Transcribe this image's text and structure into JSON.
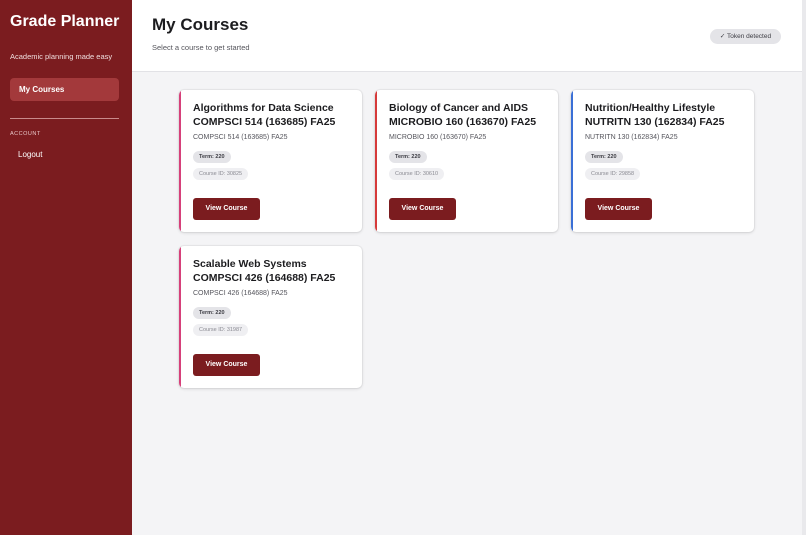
{
  "sidebar": {
    "app_title": "Grade Planner",
    "tagline": "Academic planning made easy",
    "nav_active": "My Courses",
    "section_label": "ACCOUNT",
    "logout": "Logout"
  },
  "header": {
    "title": "My Courses",
    "subtitle": "Select a course to get started",
    "badge": "✓ Token detected"
  },
  "courses": [
    {
      "title": "Algorithms for Data Science COMPSCI 514 (163685) FA25",
      "code": "COMPSCI 514 (163685) FA25",
      "term": "Term: 220",
      "course_id": "Course ID: 30825",
      "button": "View Course",
      "accent": "#d6407a"
    },
    {
      "title": "Biology of Cancer and AIDS MICROBIO 160 (163670) FA25",
      "code": "MICROBIO 160 (163670) FA25",
      "term": "Term: 220",
      "course_id": "Course ID: 30610",
      "button": "View Course",
      "accent": "#d63a3a"
    },
    {
      "title": "Nutrition/Healthy Lifestyle NUTRITN 130 (162834) FA25",
      "code": "NUTRITN 130 (162834) FA25",
      "term": "Term: 220",
      "course_id": "Course ID: 29858",
      "button": "View Course",
      "accent": "#3a6fd6"
    },
    {
      "title": "Scalable Web Systems COMPSCI 426 (164688) FA25",
      "code": "COMPSCI 426 (164688) FA25",
      "term": "Term: 220",
      "course_id": "Course ID: 31987",
      "button": "View Course",
      "accent": "#d6407a"
    }
  ],
  "colors": {
    "sidebar_bg": "#7b1c1f",
    "nav_active_bg": "#a3393b",
    "button_bg": "#7b1c1f",
    "page_bg": "#f4f4f6"
  }
}
